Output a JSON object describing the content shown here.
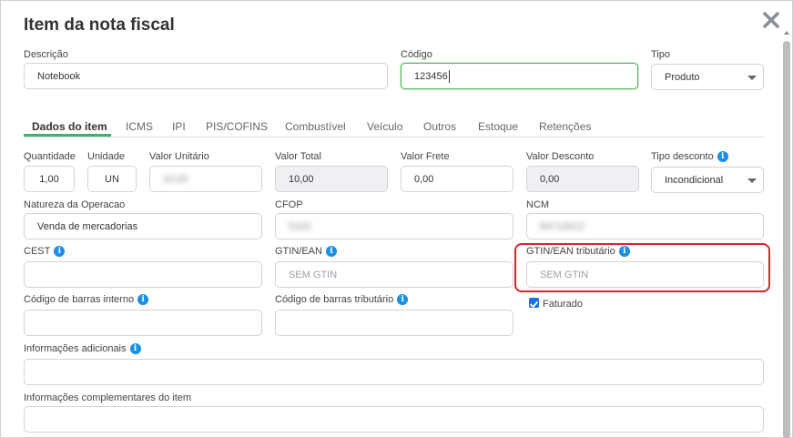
{
  "modal": {
    "title": "Item da nota fiscal"
  },
  "top": {
    "descricao_label": "Descrição",
    "descricao_value": "Notebook",
    "codigo_label": "Código",
    "codigo_value": "123456",
    "tipo_label": "Tipo",
    "tipo_value": "Produto"
  },
  "tabs": [
    {
      "label": "Dados do item",
      "active": true
    },
    {
      "label": "ICMS"
    },
    {
      "label": "IPI"
    },
    {
      "label": "PIS/COFINS"
    },
    {
      "label": "Combustível"
    },
    {
      "label": "Veículo"
    },
    {
      "label": "Outros"
    },
    {
      "label": "Estoque"
    },
    {
      "label": "Retenções"
    }
  ],
  "fields": {
    "quantidade_label": "Quantidade",
    "quantidade_value": "1,00",
    "unidade_label": "Unidade",
    "unidade_value": "UN",
    "valor_unitario_label": "Valor Unitário",
    "valor_unitario_value": "10,00",
    "valor_total_label": "Valor Total",
    "valor_total_value": "10,00",
    "valor_frete_label": "Valor Frete",
    "valor_frete_value": "0,00",
    "valor_desconto_label": "Valor Desconto",
    "valor_desconto_value": "0,00",
    "tipo_desconto_label": "Tipo desconto",
    "tipo_desconto_value": "Incondicional",
    "natureza_label": "Natureza da Operacao",
    "natureza_value": "Venda de mercadorias",
    "cfop_label": "CFOP",
    "cfop_value": "5102",
    "ncm_label": "NCM",
    "ncm_value": "84713012",
    "cest_label": "CEST",
    "gtin_label": "GTIN/EAN",
    "gtin_placeholder": "SEM GTIN",
    "gtin_trib_label": "GTIN/EAN tributário",
    "gtin_trib_placeholder": "SEM GTIN",
    "cod_barras_label": "Código de barras interno",
    "cod_barras_trib_label": "Código de barras tributário",
    "faturado_label": "Faturado",
    "faturado_checked": true,
    "info_adicionais_label": "Informações adicionais",
    "info_complementares_label": "Informações complementares do item"
  },
  "icons": {
    "close": "close-icon",
    "info": "info-icon",
    "info_glyph": "i"
  },
  "colors": {
    "accent_green": "#3cb371",
    "info_blue": "#1a8fe3",
    "highlight_red": "#d9252b"
  }
}
